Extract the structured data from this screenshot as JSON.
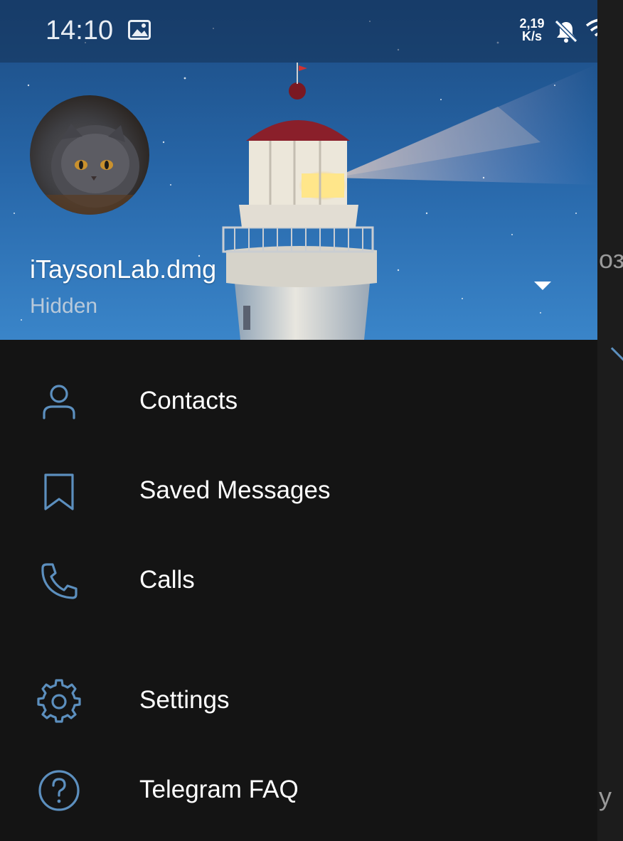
{
  "status_bar": {
    "time": "14:10",
    "speed_value": "2,19",
    "speed_unit": "K/s",
    "icons": [
      "gallery-icon",
      "mute-icon",
      "wifi-icon"
    ]
  },
  "header": {
    "user_name": "iTaysonLab.dmg",
    "phone_status": "Hidden",
    "background": "lighthouse-night-sky"
  },
  "menu": {
    "items": [
      {
        "label": "Contacts",
        "icon": "contacts-icon"
      },
      {
        "label": "Saved Messages",
        "icon": "bookmark-icon"
      },
      {
        "label": "Calls",
        "icon": "phone-icon"
      },
      {
        "label": "Settings",
        "icon": "gear-icon"
      },
      {
        "label": "Telegram FAQ",
        "icon": "help-icon"
      }
    ]
  },
  "background_app": {
    "fragment_1": "оз",
    "fragment_2": "у"
  },
  "colors": {
    "drawer_bg": "#141414",
    "icon_accent": "#5c8fbe",
    "text": "#ffffff",
    "phone_status": "#b8c9da"
  }
}
